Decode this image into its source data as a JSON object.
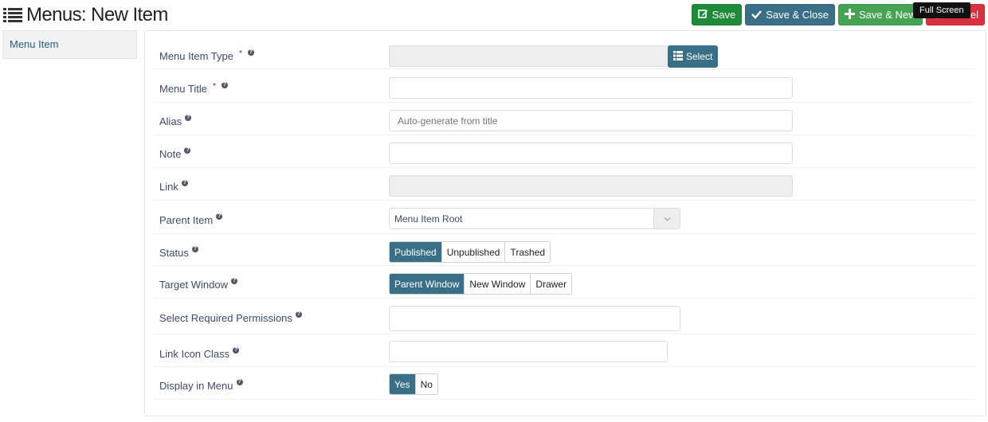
{
  "header": {
    "title": "Menus: New Item",
    "icon": "list-icon"
  },
  "toolbar": {
    "save": {
      "label": "Save",
      "icon": "edit-icon",
      "color": "#1e8b3b"
    },
    "save_close": {
      "label": "Save & Close",
      "icon": "check-icon",
      "color": "#3a7087"
    },
    "save_new": {
      "label": "Save & New",
      "icon": "plus-icon",
      "color": "#47a354"
    },
    "cancel": {
      "label": "Cancel",
      "icon": "cancel-icon",
      "color": "#d9303f"
    },
    "tooltip": "Full Screen"
  },
  "sidebar": {
    "tabs": [
      {
        "label": "Menu Item",
        "active": true
      }
    ]
  },
  "form": {
    "menu_item_type": {
      "label": "Menu Item Type",
      "required": true,
      "value": "",
      "select_label": "Select"
    },
    "menu_title": {
      "label": "Menu Title",
      "required": true,
      "value": ""
    },
    "alias": {
      "label": "Alias",
      "value": "",
      "placeholder": "Auto-generate from title"
    },
    "note": {
      "label": "Note",
      "value": ""
    },
    "link": {
      "label": "Link",
      "value": ""
    },
    "parent_item": {
      "label": "Parent Item",
      "value": "Menu Item Root"
    },
    "status": {
      "label": "Status",
      "options": [
        "Published",
        "Unpublished",
        "Trashed"
      ],
      "selected": "Published"
    },
    "target_window": {
      "label": "Target Window",
      "options": [
        "Parent Window",
        "New Window",
        "Drawer"
      ],
      "selected": "Parent Window"
    },
    "permissions": {
      "label": "Select Required Permissions",
      "value": ""
    },
    "link_icon_class": {
      "label": "Link Icon Class",
      "value": ""
    },
    "display_in_menu": {
      "label": "Display in Menu",
      "options": [
        "Yes",
        "No"
      ],
      "selected": "Yes"
    }
  },
  "colors": {
    "primary": "#3a7087",
    "label": "#3c4a6b",
    "required": "#cc0000"
  }
}
